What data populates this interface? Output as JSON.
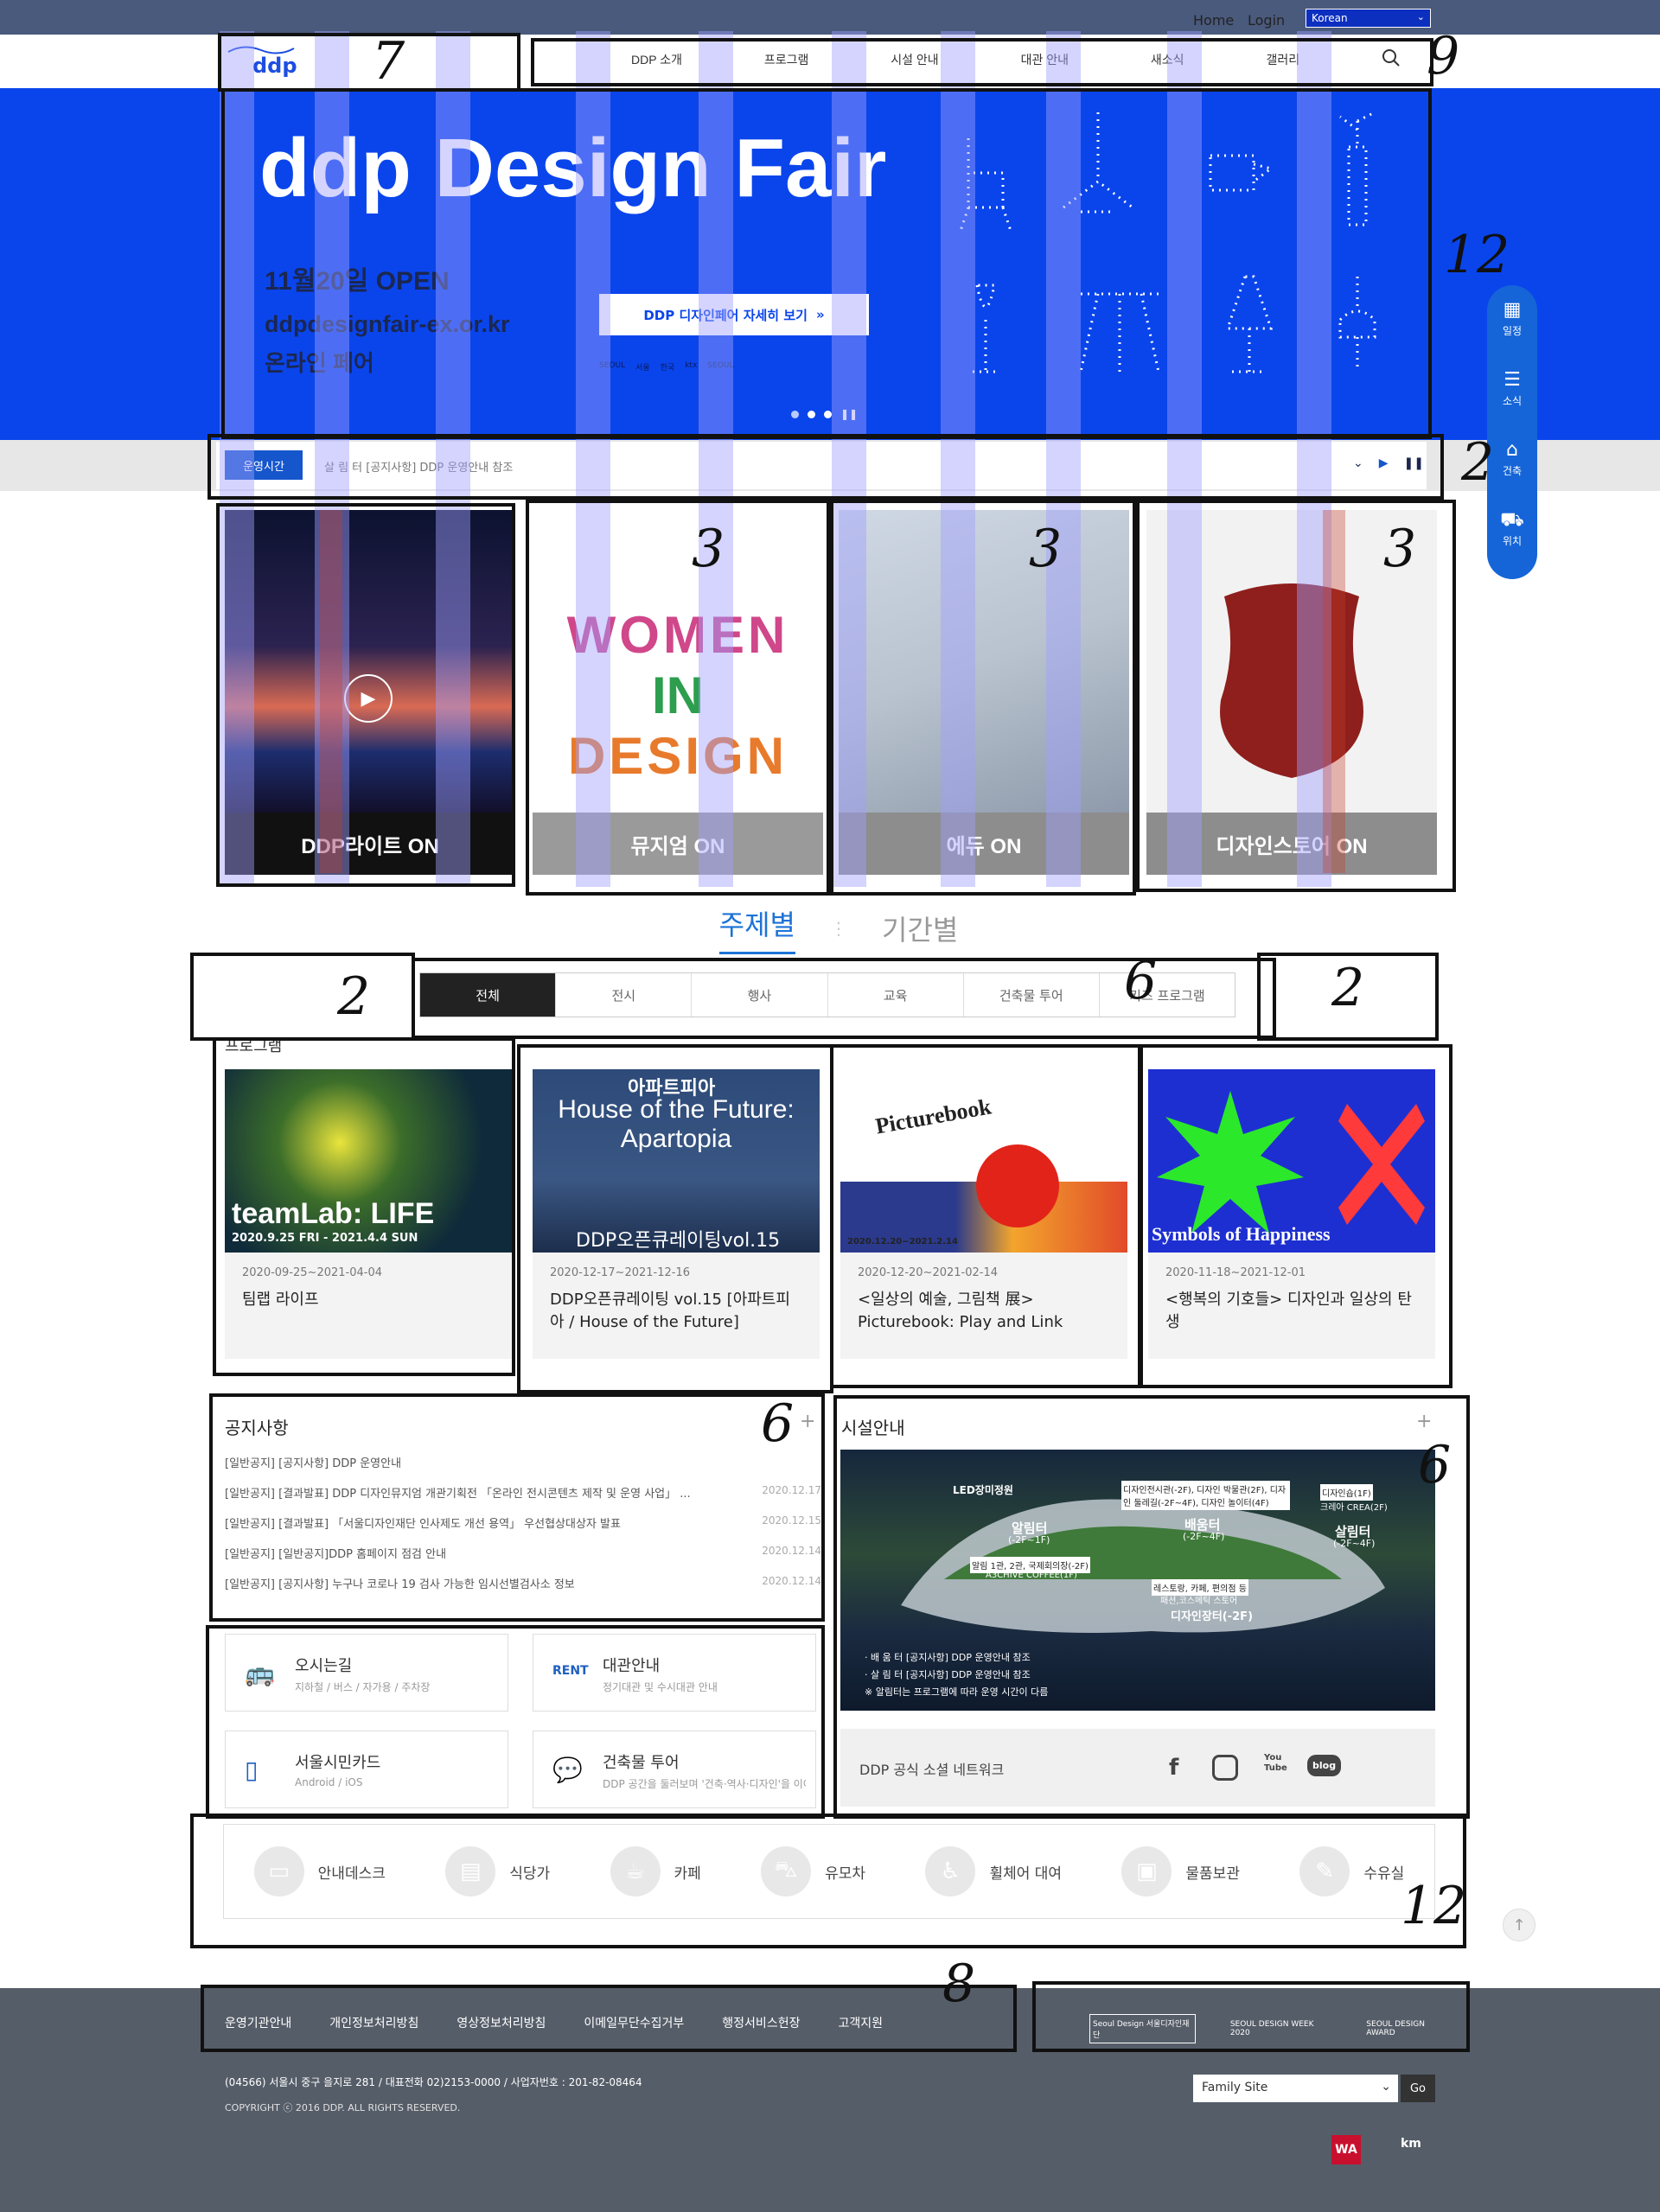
{
  "topbar": {
    "home": "Home",
    "login": "Login",
    "language": "Korean"
  },
  "header": {
    "logo": "ddp",
    "nav": [
      "DDP 소개",
      "프로그램",
      "시설 안내",
      "대관 안내",
      "새소식",
      "갤러리"
    ]
  },
  "hero": {
    "title": "ddp Design Fair",
    "date": "11월20일 OPEN",
    "url": "ddpdesignfair-ex.or.kr",
    "subtitle": "온라인 페어",
    "button": "DDP 디자인페어 자세히 보기",
    "sponsors": [
      "SEOUL",
      "서울",
      "한국",
      "ktx",
      "SEOUL"
    ]
  },
  "notice_bar": {
    "tag": "운영시간",
    "text": "살 림 터 [공지사항] DDP 운영안내 참조"
  },
  "side_menu": [
    "일정",
    "소식",
    "건축",
    "위치"
  ],
  "feature_cards": [
    {
      "label": "DDP라이트 ON"
    },
    {
      "label": "뮤지엄 ON"
    },
    {
      "label": "에듀 ON"
    },
    {
      "label": "디자인스토어 ON"
    }
  ],
  "women_in_design": [
    "WOMEN",
    "IN",
    "DESIGN"
  ],
  "program_tabs": {
    "active": "주제별",
    "other": "기간별"
  },
  "categories": [
    "전체",
    "전시",
    "행사",
    "교육",
    "건축물 투어",
    "키즈 프로그램"
  ],
  "program_title": "프로그램",
  "programs": [
    {
      "date": "2020-09-25~2021-04-04",
      "name": "팀랩 라이프",
      "img_text": "teamLab: LIFE",
      "img_sub": "2020.9.25 FRI - 2021.4.4 SUN"
    },
    {
      "date": "2020-12-17~2021-12-16",
      "name": "DDP오픈큐레이팅 vol.15 [아파트피아 / House of the Future]",
      "img_text": "House of the Future: Apartopia",
      "img_top": "아파트피아",
      "img_sub": "DDP오픈큐레이팅vol.15"
    },
    {
      "date": "2020-12-20~2021-02-14",
      "name": "<일상의 예술, 그림책 展> Picturebook: Play and Link",
      "img_text": "Picturebook",
      "img_sub": "2020.12.20~2021.2.14"
    },
    {
      "date": "2020-11-18~2021-12-01",
      "name": "<행복의 기호들> 디자인과 일상의 탄생",
      "img_text": "Symbols of Happiness"
    }
  ],
  "notices": {
    "title": "공지사항",
    "items": [
      {
        "text": "[일반공지] [공지사항] DDP 운영안내",
        "date": ""
      },
      {
        "text": "[일반공지] [결과발표] DDP 디자인뮤지엄 개관기획전 「온라인 전시콘텐츠 제작 및 운영 사업」 ...",
        "date": "2020.12.17"
      },
      {
        "text": "[일반공지] [결과발표] 「서울디자인재단 인사제도 개선 용역」 우선협상대상자 발표",
        "date": "2020.12.15"
      },
      {
        "text": "[일반공지] [일반공지]DDP 홈페이지 점검 안내",
        "date": "2020.12.14"
      },
      {
        "text": "[일반공지] [공지사항] 누구나 코로나 19 검사 가능한 임시선별검사소 정보",
        "date": "2020.12.14"
      }
    ]
  },
  "quick_links": [
    {
      "title": "오시는길",
      "sub": "지하철 / 버스 / 자가용 / 주차장",
      "icon": "bus-icon"
    },
    {
      "title": "대관안내",
      "sub": "정기대관 및 수시대관 안내",
      "icon": "rent-icon"
    },
    {
      "title": "서울시민카드",
      "sub": "Android / iOS",
      "icon": "phone-icon"
    },
    {
      "title": "건축물 투어",
      "sub": "DDP 공간을 둘러보며 '건축·역사·디자인'을 이야기합니다",
      "icon": "chat-icon"
    }
  ],
  "facility": {
    "title": "시설안내",
    "labels": [
      "LED장미정원",
      "디자인전시관(-2F), 디자인 박물관(2F), 디자인 둘레길(-2F~4F), 디자인 놀이터(4F)",
      "디자인숍(1F)",
      "크레아 CREA(2F)",
      "알림터",
      "(-2F~1F)",
      "배움터",
      "(-2F~4F)",
      "살림터",
      "(-2F~4F)",
      "알림 1관, 2관, 국제회의장(-2F)",
      "A3CHIVE COFFEE(1F)",
      "레스토랑, 카페, 편의점 등",
      "패션,코스메틱 스토어",
      "디자인장터(-2F)"
    ],
    "notes": [
      "· 배 움 터  [공지사항] DDP 운영안내 참조",
      "· 살 림 터  [공지사항] DDP 운영안내 참조",
      "※ 알림터는 프로그램에 따라 운영 시간이 다름"
    ]
  },
  "social": {
    "title": "DDP 공식 소셜 네트워크",
    "blog": "blog",
    "youtube": "You Tube"
  },
  "amenities": [
    "안내데스크",
    "식당가",
    "카페",
    "유모차",
    "휠체어 대여",
    "물품보관",
    "수유실"
  ],
  "footer": {
    "links": [
      "운영기관안내",
      "개인정보처리방침",
      "영상정보처리방침",
      "이메일무단수집거부",
      "행정서비스헌장",
      "고객지원"
    ],
    "address": "(04566) 서울시 중구 을지로 281 / 대표전화 02)2153-0000 / 사업자번호 : 201-82-08464",
    "copyright": "COPYRIGHT ⓒ 2016 DDP. ALL RIGHTS RESERVED.",
    "family_site": "Family Site",
    "go": "Go",
    "partners": [
      "Seoul Design 서울디자인재단",
      "SEOUL DESIGN WEEK 2020",
      "SEOUL DESIGN AWARD"
    ]
  },
  "colors": {
    "brand_blue": "#0a45ec",
    "side_blue": "#1565d8",
    "footer_gray": "#555d68"
  }
}
